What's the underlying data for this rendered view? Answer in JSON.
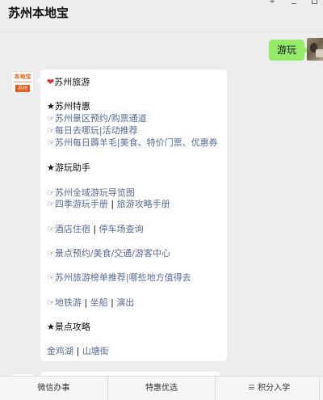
{
  "header": {
    "title": "苏州本地宝"
  },
  "chat": {
    "user_message": "游玩",
    "bot_logo": {
      "top": "本地宝",
      "bottom": "苏州"
    },
    "reply": {
      "title": "苏州旅游",
      "sections": {
        "specials_heading": "★苏州特惠",
        "specials_1": "☞苏州景区预约/购票通道",
        "specials_2": "☞每日去哪玩|活动推荐",
        "specials_3": "☞苏州每日薅羊毛|美食、特价门票、优惠券",
        "helper_heading": "★游玩助手",
        "helper_1": "☞苏州全域游玩导览图",
        "helper_2a": "☞四季游玩手册",
        "helper_2b": "旅游攻略手册",
        "helper_3a": "☞酒店住宿",
        "helper_3b": "停车场查询",
        "helper_4": "☞景点预约/美食/交通/游客中心",
        "helper_5": "☞苏州旅游榜单推荐|哪些地方值得去",
        "helper_6a": "☞地铁游",
        "helper_6b": "坐船",
        "helper_6c": "演出",
        "attractions_heading": "★景点攻略",
        "attr_1": "金鸡湖",
        "attr_2": "山塘街",
        "divider": "|"
      }
    }
  },
  "menu": {
    "item_1": "微信办事",
    "item_2": "特惠优选",
    "item_3": "积分入学"
  },
  "colors": {
    "bubble_green": "#95ec69",
    "link_blue": "#576b95",
    "heart_red": "#e0303a"
  }
}
